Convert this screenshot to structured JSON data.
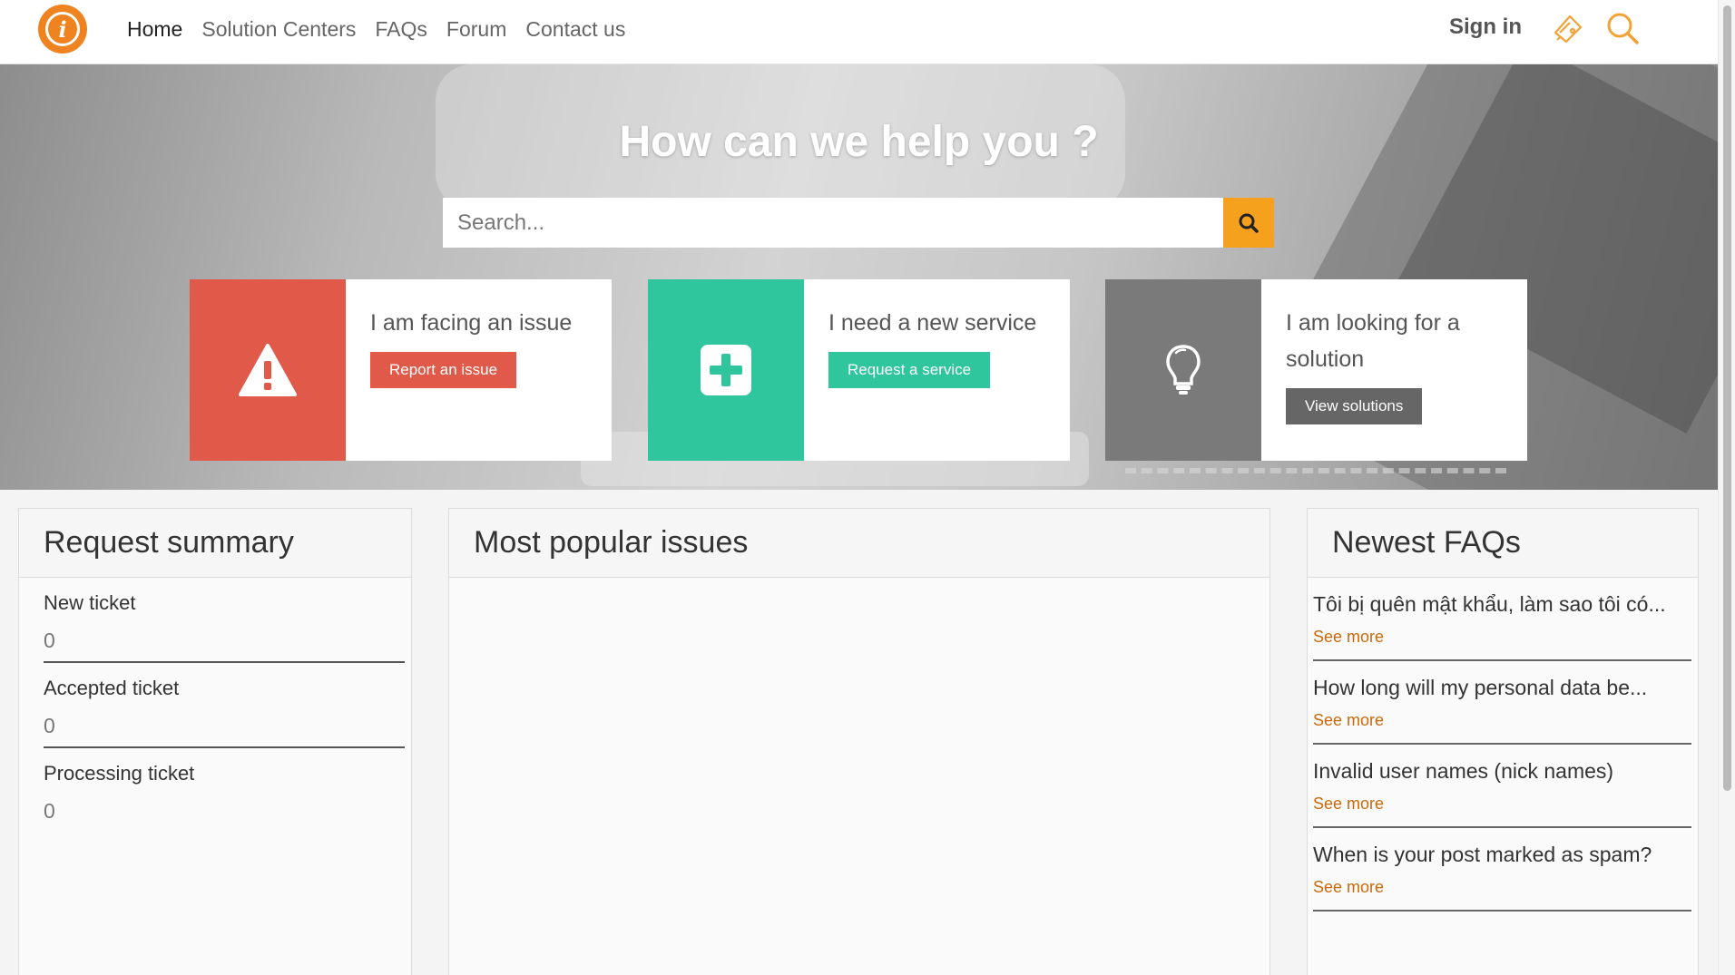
{
  "nav": {
    "items": [
      "Home",
      "Solution Centers",
      "FAQs",
      "Forum",
      "Contact us"
    ],
    "active": "Home",
    "signin_label": "Sign in"
  },
  "hero": {
    "title": "How can we help you ?",
    "search_placeholder": "Search..."
  },
  "cards": [
    {
      "title": "I am facing an issue",
      "button": "Report an issue",
      "color": "#e15a49",
      "icon": "warning-icon"
    },
    {
      "title": "I need a new service",
      "button": "Request a service",
      "color": "#2fc59d",
      "icon": "plus-square-icon"
    },
    {
      "title": "I am looking for a solution",
      "button": "View solutions",
      "color": "#7a7a7a",
      "button_color": "#666666",
      "icon": "lightbulb-icon"
    }
  ],
  "request_summary": {
    "title": "Request summary",
    "items": [
      {
        "label": "New ticket",
        "value": "0"
      },
      {
        "label": "Accepted ticket",
        "value": "0"
      },
      {
        "label": "Processing ticket",
        "value": "0"
      }
    ]
  },
  "popular": {
    "title": "Most popular issues"
  },
  "faqs": {
    "title": "Newest FAQs",
    "items": [
      {
        "q": "Tôi bị quên mật khẩu, làm sao tôi có...",
        "more": "See more"
      },
      {
        "q": "How long will my personal data be...",
        "more": "See more"
      },
      {
        "q": "Invalid user names (nick names)",
        "more": "See more"
      },
      {
        "q": "When is your post marked as spam?",
        "more": "See more"
      }
    ]
  },
  "colors": {
    "accent": "#f5a11d",
    "link": "#c76a0b"
  }
}
